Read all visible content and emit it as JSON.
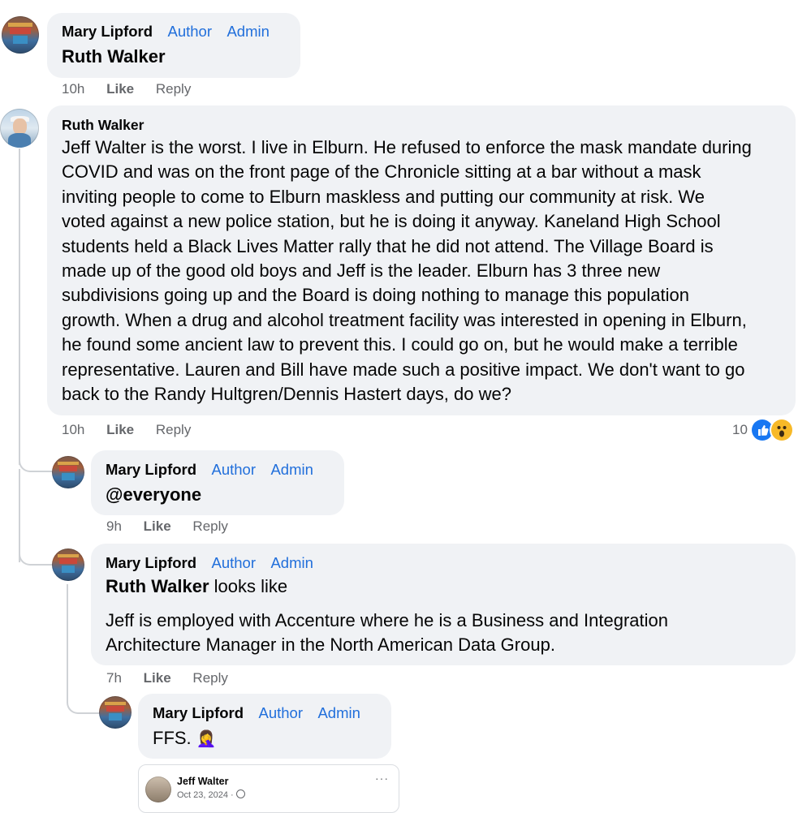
{
  "comments": [
    {
      "author": "Mary Lipford",
      "badges": [
        "Author",
        "Admin"
      ],
      "mention": "Ruth Walker",
      "time": "10h",
      "like": "Like",
      "reply": "Reply"
    },
    {
      "author": "Ruth Walker",
      "text": "Jeff Walter is the worst. I live in Elburn. He refused to enforce the mask mandate during COVID and was on the front page of the Chronicle sitting at a bar without a mask inviting people to come to Elburn maskless and putting our community at risk. We voted against a new police station, but he is doing it anyway. Kaneland High School students held a Black Lives Matter rally that he did not attend. The Village Board is made up of the good old boys and Jeff is the leader. Elburn has 3 three new subdivisions going up and the Board is doing nothing to manage this population growth. When a drug and alcohol treatment facility was interested in opening in Elburn, he found some ancient law to prevent this. I could go on, but he would make a terrible representative. Lauren and Bill have made such a positive impact. We don't want to go back to the Randy Hultgren/Dennis Hastert days, do we?",
      "lines": [
        "Jeff Walter is the worst. I live in Elburn. He refused to enforce the mask mandate during",
        "COVID and was on the front page of the Chronicle sitting at a bar without a mask",
        "inviting people to come to Elburn maskless and putting our community at risk. We",
        "voted against a new police station, but he is doing it anyway. Kaneland High School",
        "students held a Black Lives Matter rally that he did not attend. The Village Board is",
        "made up of the good old boys and Jeff is the leader. Elburn has 3 three new",
        "subdivisions going up and the Board is doing nothing to manage this population",
        "growth. When a drug and alcohol treatment facility was interested in opening in Elburn,",
        "he found some ancient law to prevent this. I could go on, but he would make a terrible",
        "representative. Lauren and Bill have made such a positive impact. We don't want to go",
        "back to the Randy Hultgren/Dennis Hastert days, do we?"
      ],
      "time": "10h",
      "like": "Like",
      "reply": "Reply",
      "reaction_count": "10",
      "reactions": [
        "like-reaction",
        "wow-reaction"
      ]
    },
    {
      "author": "Mary Lipford",
      "badges": [
        "Author",
        "Admin"
      ],
      "mention": "@everyone",
      "time": "9h",
      "like": "Like",
      "reply": "Reply"
    },
    {
      "author": "Mary Lipford",
      "badges": [
        "Author",
        "Admin"
      ],
      "mention": "Ruth Walker",
      "after_mention": " looks like",
      "text_lines": [
        "Jeff is employed with Accenture where he is a Business and Integration",
        "Architecture Manager in the North American Data Group."
      ],
      "time": "7h",
      "like": "Like",
      "reply": "Reply"
    },
    {
      "author": "Mary Lipford",
      "badges": [
        "Author",
        "Admin"
      ],
      "text": "FFS.",
      "emoji": "🤦‍♀️"
    }
  ],
  "shared_card": {
    "author": "Jeff Walter",
    "date": "Oct 23, 2024 ·",
    "more": "···"
  },
  "colors": {
    "bubble": "#f0f2f5",
    "badge": "#216fdb",
    "meta": "#65676b",
    "thread_line": "#cfd2d6"
  }
}
